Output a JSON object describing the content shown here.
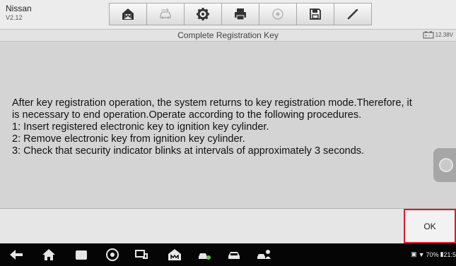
{
  "app": {
    "name": "Nissan",
    "version": "V2.12"
  },
  "toolbar": {
    "tools": [
      {
        "name": "home-tool-button",
        "icon": "home-icon"
      },
      {
        "name": "vehicle-swap-tool-button",
        "icon": "car-swap-icon"
      },
      {
        "name": "settings-tool-button",
        "icon": "gear-icon"
      },
      {
        "name": "print-tool-button",
        "icon": "printer-icon"
      },
      {
        "name": "help-tool-button",
        "icon": "help-icon"
      },
      {
        "name": "save-tool-button",
        "icon": "floppy-disk-icon"
      },
      {
        "name": "edit-tool-button",
        "icon": "pen-icon"
      }
    ]
  },
  "title": "Complete Registration Key",
  "battery_voltage": "12.38V",
  "message": {
    "lines": [
      "After key registration operation, the system returns to key registration mode.Therefore, it",
      "is necessary to end operation.Operate according to the following procedures.",
      "1: Insert registered electronic key to ignition key cylinder.",
      "2: Remove electronic key from ignition key cylinder.",
      "3: Check that security indicator blinks at intervals of approximately 3 seconds."
    ]
  },
  "ok_label": "OK",
  "status_bar": {
    "battery_percent": "70%",
    "time": "21:5"
  },
  "colors": {
    "ok_border": "#e0192d",
    "background": "#d4d4d4"
  }
}
